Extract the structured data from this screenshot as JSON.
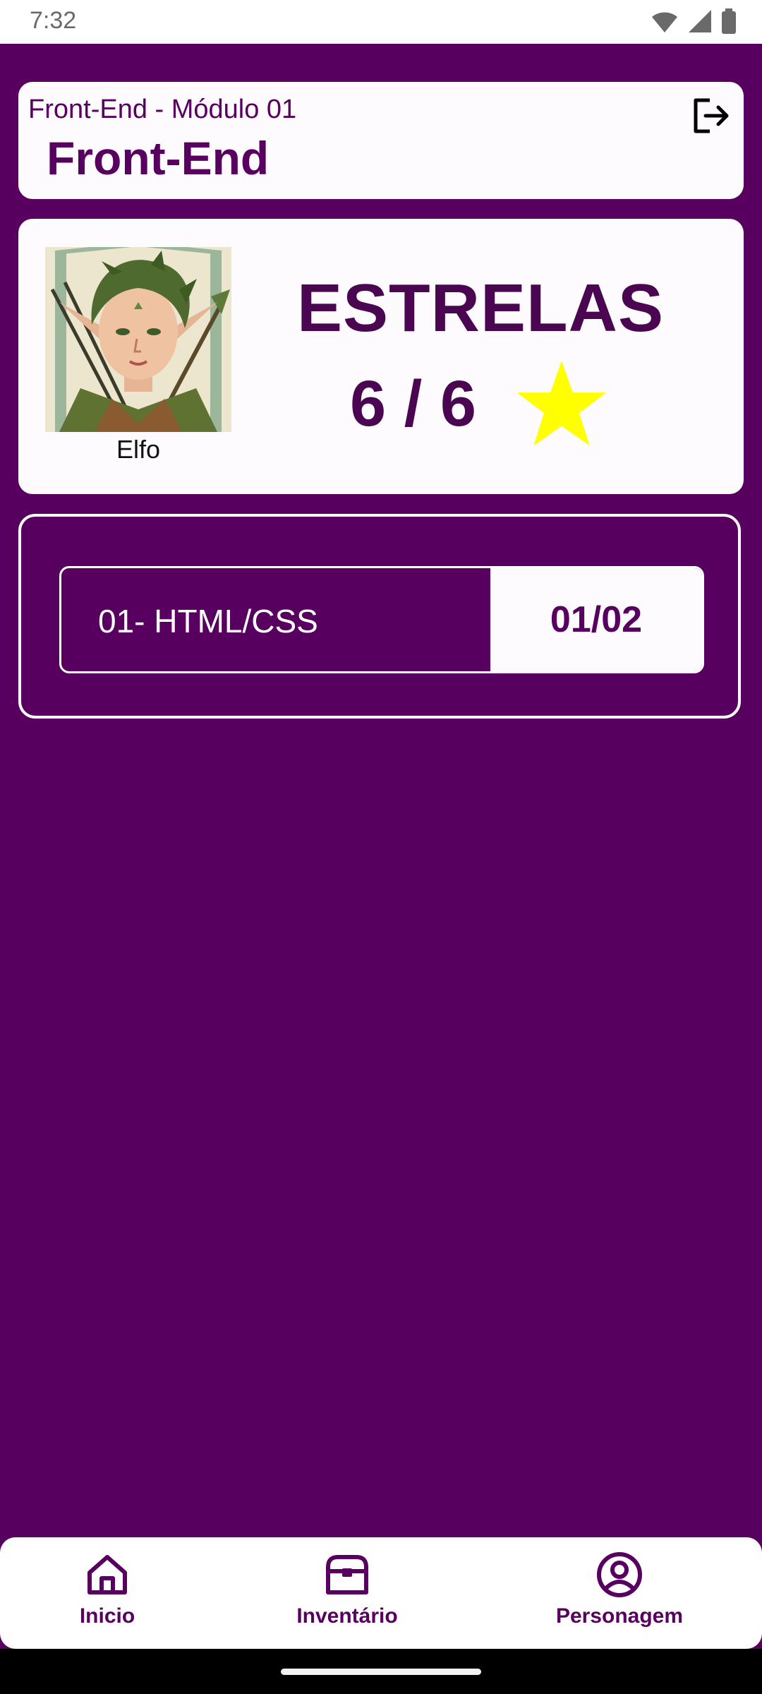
{
  "status_bar": {
    "time": "7:32",
    "icons": [
      "wifi-icon",
      "signal-icon",
      "battery-icon"
    ]
  },
  "header": {
    "module_line": "Front-End - Módulo 01",
    "title": "Front-End",
    "logout_icon": "logout-icon"
  },
  "character": {
    "name": "Elfo",
    "stars_title": "ESTRELAS",
    "stars_count": "6 / 6",
    "star_color": "#ffff00"
  },
  "modules": [
    {
      "name": "01- HTML/CSS",
      "progress": "01/02"
    }
  ],
  "bottom_nav": {
    "items": [
      {
        "label": "Inicio",
        "icon": "home-icon"
      },
      {
        "label": "Inventário",
        "icon": "chest-icon"
      },
      {
        "label": "Personagem",
        "icon": "user-circle-icon"
      }
    ]
  },
  "colors": {
    "primary": "#58005f",
    "card": "#fdfbfd",
    "accent_star": "#ffff00"
  }
}
